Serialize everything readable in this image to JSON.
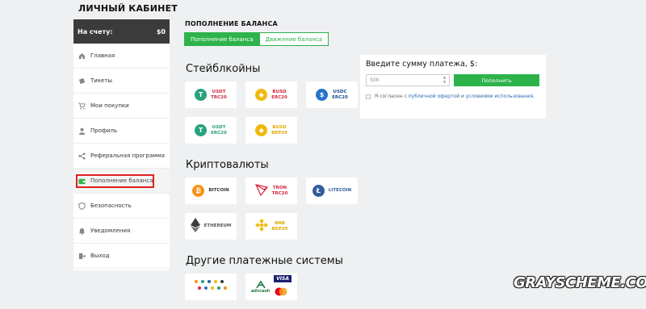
{
  "sidebar": {
    "title": "ЛИЧНЫЙ КАБИНЕТ",
    "balance_label": "На счету:",
    "balance_value": "$0",
    "items": [
      {
        "label": "Главная"
      },
      {
        "label": "Тикеты"
      },
      {
        "label": "Мои покупки"
      },
      {
        "label": "Профиль"
      },
      {
        "label": "Реферальная программа"
      },
      {
        "label": "Пополнение баланса"
      },
      {
        "label": "Безопасность"
      },
      {
        "label": "Уведомления"
      },
      {
        "label": "Выход"
      }
    ]
  },
  "main": {
    "title": "ПОПОЛНЕНИЕ БАЛАНСА",
    "tabs": [
      {
        "label": "Пополнение баланса"
      },
      {
        "label": "Движение баланса"
      }
    ],
    "stablecoins_title": "Стейблкойны",
    "crypto_title": "Криптовалюты",
    "other_title": "Другие платежные системы",
    "stablecoins": [
      {
        "line1": "USDT",
        "line2": "TRC20",
        "color": "#26a17b",
        "text_color": "#d7263d"
      },
      {
        "line1": "BUSD",
        "line2": "ERC20",
        "color": "#f0b90b",
        "text_color": "#d7263d"
      },
      {
        "line1": "USDC",
        "line2": "ERC20",
        "color": "#2775ca",
        "text_color": "#1e4f91"
      },
      {
        "line1": "USDT",
        "line2": "ERC20",
        "color": "#26a17b",
        "text_color": "#26a17b"
      },
      {
        "line1": "BUSD",
        "line2": "BEP20",
        "color": "#f0b90b",
        "text_color": "#e0a800"
      }
    ],
    "cryptos": [
      {
        "line1": "BITCOIN",
        "line2": "",
        "color": "#f7931a",
        "text_color": "#333"
      },
      {
        "line1": "TRON",
        "line2": "TRC20",
        "color": "#d7263d",
        "text_color": "#d7263d"
      },
      {
        "line1": "LITECOIN",
        "line2": "",
        "color": "#345d9d",
        "text_color": "#345d9d"
      },
      {
        "line1": "ETHEREUM",
        "line2": "",
        "color": "#3c3c3d",
        "text_color": "#555"
      },
      {
        "line1": "BNB",
        "line2": "BEP20",
        "color": "#f0b90b",
        "text_color": "#e0a800"
      }
    ],
    "other": [
      {
        "name": "mixed-coins"
      },
      {
        "line1": "advcash",
        "line2": "",
        "brand": "VISA"
      }
    ]
  },
  "payment": {
    "title": "Введите сумму платежа, $:",
    "amount_value": "500",
    "button_label": "Пополнить",
    "agree_prefix": "Я согласен с ",
    "agree_link1": "публичной офертой",
    "agree_mid": " и ",
    "agree_link2": "условиями использования",
    "agree_suffix": "."
  },
  "watermark": "GRAYSCHEME.COM"
}
